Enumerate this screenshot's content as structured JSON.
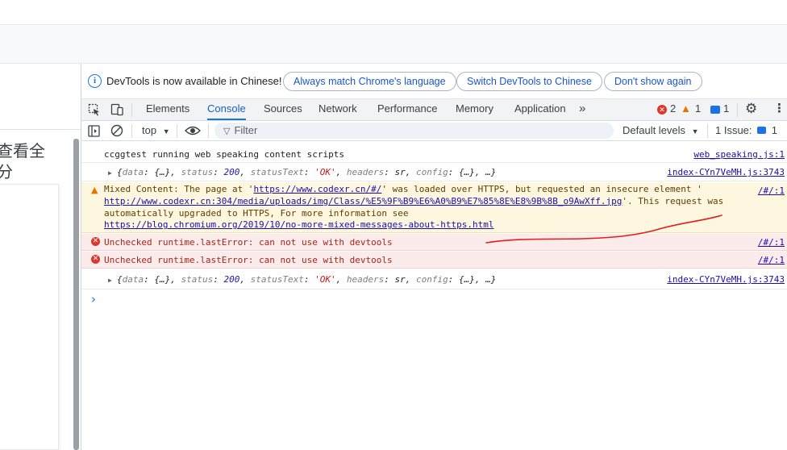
{
  "page": {
    "cjk_text_line1": "查看全",
    "cjk_text_line2": "分"
  },
  "devtools": {
    "info_bar": {
      "message": "DevTools is now available in Chinese!",
      "buttons": [
        "Always match Chrome's language",
        "Switch DevTools to Chinese",
        "Don't show again"
      ]
    },
    "tabs": [
      "Elements",
      "Console",
      "Sources",
      "Network",
      "Performance",
      "Memory",
      "Application"
    ],
    "active_tab": "Console",
    "more_tabs_icon": "double-chevron-icon",
    "counts": {
      "errors": "2",
      "warnings": "1",
      "messages": "1"
    },
    "toolbar": {
      "context": "top",
      "filter_placeholder": "Filter",
      "levels": "Default levels",
      "issues_label": "1 Issue:",
      "issues_count": "1"
    },
    "console": {
      "log1": {
        "text": "ccggtest running web speaking content scripts",
        "source": "web_speaking.js:1"
      },
      "obj1": {
        "open": "{",
        "k1": "data",
        "v1": "{…}",
        "k2": "status",
        "v2": "200",
        "k3": "statusText",
        "v3": "'OK'",
        "k4": "headers",
        "v4": "sr",
        "k5": "config",
        "v5": "{…}",
        "tail": "…}",
        "source": "index-CYn7VeMH.js:3743"
      },
      "warning": {
        "part1": "Mixed Content: The page at '",
        "url1": "https://www.codexr.cn/#/",
        "part2": "' was loaded over HTTPS, but requested an insecure element '",
        "url2": "http://www.codexr.cn:304/media/uploads/img/Class/%E5%9F%B9%E6%A0%B9%E7%85%8E%E8%9B%8B_o9AwXff.jpg",
        "part3": "'. This request was",
        "line3": "automatically upgraded to HTTPS, For more information see",
        "url3": "https://blog.chromium.org/2019/10/no-more-mixed-messages-about-https.html",
        "source": "/#/:1"
      },
      "error1": {
        "text": "Unchecked runtime.lastError: can not use with devtools",
        "source": "/#/:1"
      },
      "error2": {
        "text": "Unchecked runtime.lastError: can not use with devtools",
        "source": "/#/:1"
      },
      "obj2": {
        "source": "index-CYn7VeMH.js:3743"
      },
      "prompt": "›"
    },
    "colors": {
      "accent": "#1a73e8",
      "error": "#dc362e",
      "warning": "#e37400",
      "annotation": "#e0201c"
    }
  }
}
